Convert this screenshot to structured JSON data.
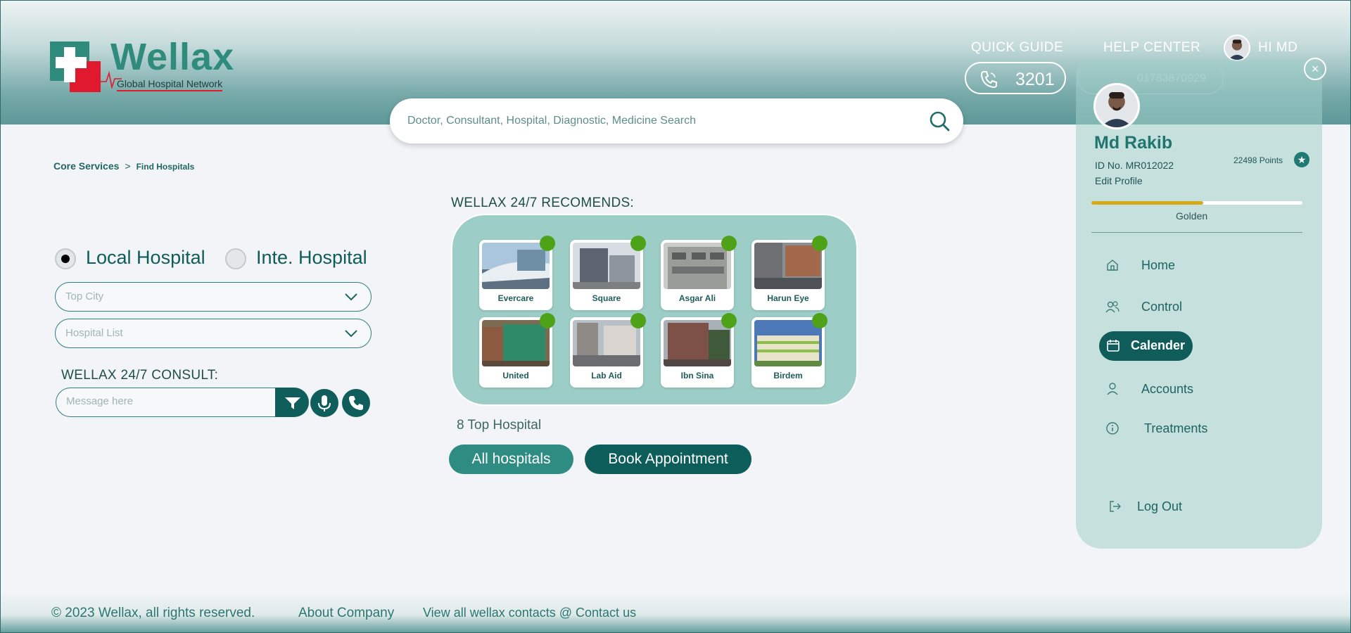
{
  "brand": {
    "name": "Wellax",
    "tagline": "Global Hospital Network",
    "colors": {
      "primary": "#0f5c5a",
      "accent": "#2e8c83",
      "red": "#e0192e",
      "badge": "#4ea218"
    }
  },
  "header": {
    "quick_guide": "QUICK GUIDE",
    "help_center": "HELP CENTER",
    "greeting": "HI MD",
    "hotline": "3201",
    "hotline_secondary": "01783870929",
    "search_placeholder": "Doctor, Consultant, Hospital, Diagnostic, Medicine Search"
  },
  "breadcrumb": {
    "root": "Core Services",
    "separator": ">",
    "current": "Find Hospitals"
  },
  "filters": {
    "options": [
      {
        "label": "Local Hospital",
        "selected": true
      },
      {
        "label": "Inte. Hospital",
        "selected": false
      }
    ],
    "city_select": "Top City",
    "hospital_select": "Hospital List"
  },
  "consult": {
    "title": "WELLAX 24/7 CONSULT:",
    "message_placeholder": "Message here"
  },
  "recommendations": {
    "title": "WELLAX 24/7 RECOMENDS:",
    "hospitals": [
      {
        "name": "Evercare",
        "tone": "#6f8fa6"
      },
      {
        "name": "Square",
        "tone": "#5b6470"
      },
      {
        "name": "Asgar Ali",
        "tone": "#9a9c98"
      },
      {
        "name": "Harun Eye",
        "tone": "#6d6f72"
      },
      {
        "name": "United",
        "tone": "#7a6b52"
      },
      {
        "name": "Lab Aid",
        "tone": "#8f8a86"
      },
      {
        "name": "Ibn Sina",
        "tone": "#7d5148"
      },
      {
        "name": "Birdem",
        "tone": "#4d78b8"
      }
    ],
    "count_label": "8 Top Hospital",
    "all_button": "All hospitals",
    "book_button": "Book Appointment"
  },
  "profile": {
    "name": "Md Rakib",
    "id_label": "ID No. MR012022",
    "edit_label": "Edit Profile",
    "points": "22498 Points",
    "tier": "Golden",
    "tier_progress": 0.53,
    "close_label": "×",
    "nav": [
      {
        "label": "Home",
        "icon": "home-icon",
        "active": false
      },
      {
        "label": "Control",
        "icon": "users-icon",
        "active": false
      },
      {
        "label": "Calender",
        "icon": "calendar-icon",
        "active": true
      },
      {
        "label": "Accounts",
        "icon": "user-icon",
        "active": false
      },
      {
        "label": "Treatments",
        "icon": "info-icon",
        "active": false
      }
    ],
    "logout": "Log Out"
  },
  "footer": {
    "copyright": "© 2023 Wellax, all rights reserved.",
    "about": "About Company",
    "contacts": "View all wellax contacts @ Contact us"
  }
}
